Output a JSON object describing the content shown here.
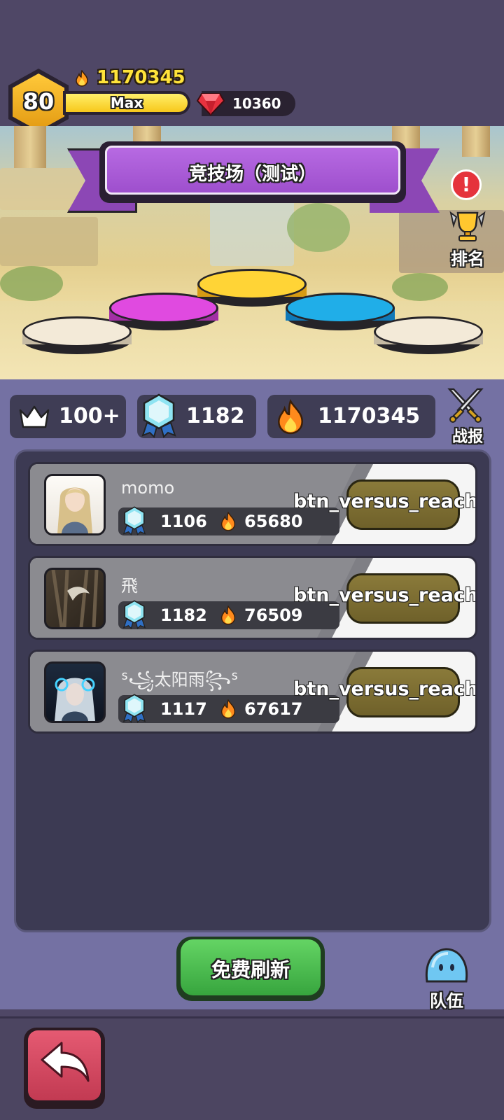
{
  "header": {
    "level": "80",
    "exp_label": "Max",
    "power": "1170345",
    "gems": "10360"
  },
  "arena": {
    "title": "竞技场（测试）",
    "rank_label": "排名"
  },
  "stats": {
    "rank": "100+",
    "trophies": "1182",
    "power": "1170345",
    "battle_report_label": "战报"
  },
  "opponents": [
    {
      "name": "momo",
      "trophies": "1106",
      "power": "65680",
      "button_label": "btn_versus_reach_m"
    },
    {
      "name": "飛",
      "trophies": "1182",
      "power": "76509",
      "button_label": "btn_versus_reach_m"
    },
    {
      "name": "ᔆ꧁太阳雨꧂ᔆ",
      "trophies": "1117",
      "power": "67617",
      "button_label": "btn_versus_reach_m"
    }
  ],
  "footer": {
    "refresh_label": "免费刷新",
    "team_label": "队伍"
  },
  "icons": {
    "level": "hexagon-badge-icon",
    "power": "flame-icon",
    "gems": "ruby-icon",
    "trophy": "crystal-medal-icon",
    "rank": "crown-icon",
    "alert": "exclamation-icon",
    "ranking": "trophy-cup-icon",
    "battle_report": "crossed-swords-icon",
    "team": "blob-creature-icon",
    "back": "back-arrow-icon"
  }
}
